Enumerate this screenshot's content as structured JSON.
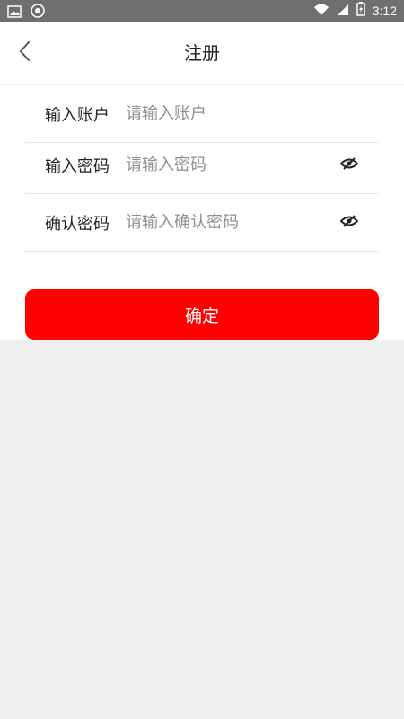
{
  "status_bar": {
    "time": "3:12",
    "icons": [
      "image-icon",
      "app-badge-icon",
      "wifi-icon",
      "signal-icon",
      "battery-charging-icon"
    ]
  },
  "header": {
    "title": "注册",
    "back_icon": "chevron-left-icon"
  },
  "form": {
    "account": {
      "label": "输入账户",
      "placeholder": "请输入账户",
      "value": ""
    },
    "password": {
      "label": "输入密码",
      "placeholder": "请输入密码",
      "value": "",
      "toggle_icon": "eye-hidden-icon"
    },
    "confirm_password": {
      "label": "确认密码",
      "placeholder": "请输入确认密码",
      "value": "",
      "toggle_icon": "eye-hidden-icon"
    }
  },
  "actions": {
    "confirm_label": "确定"
  },
  "colors": {
    "accent": "#ff0000",
    "status_bar": "#6f6f6f",
    "background": "#efefef"
  }
}
